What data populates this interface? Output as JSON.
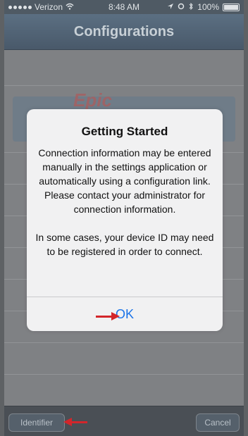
{
  "status_bar": {
    "carrier": "Verizon",
    "time": "8:48 AM",
    "battery": "100%"
  },
  "nav": {
    "title": "Configurations"
  },
  "background": {
    "logo_text": "Epic"
  },
  "alert": {
    "title": "Getting Started",
    "message": "Connection information may be entered manually in the settings application or automatically using a configuration link.  Please contact your administrator for connection information.\n\nIn some cases, your device ID may need to be registered in order to connect.",
    "ok_label": "OK"
  },
  "toolbar": {
    "identifier_label": "Identifier",
    "cancel_label": "Cancel"
  },
  "colors": {
    "annotation_arrow": "#d3262b",
    "ok_blue": "#1a73e8"
  }
}
